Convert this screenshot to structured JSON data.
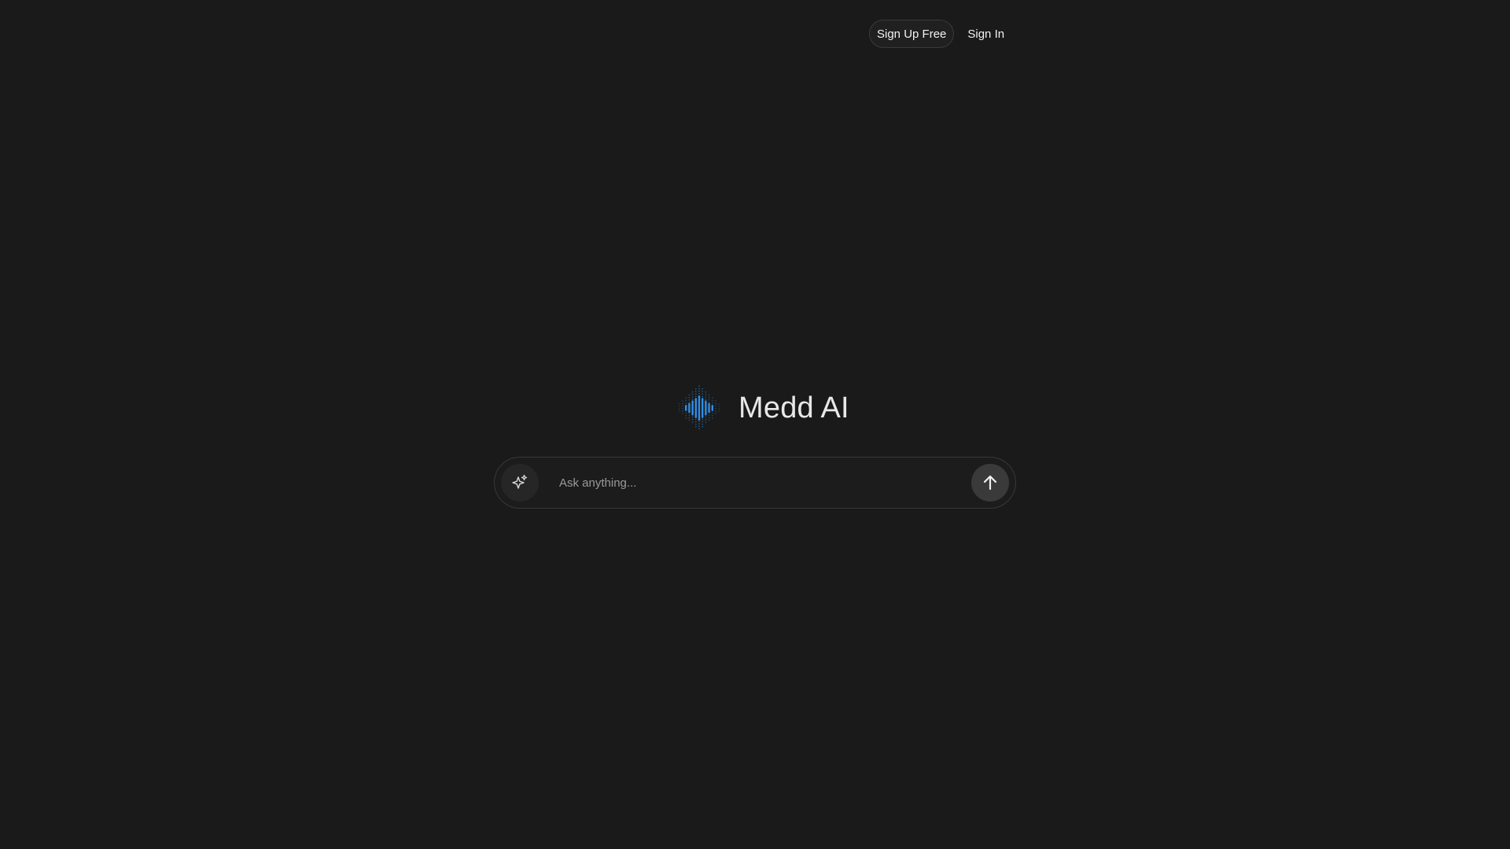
{
  "header": {
    "signup_label": "Sign Up Free",
    "signin_label": "Sign In"
  },
  "brand": {
    "name": "Medd AI",
    "logo_icon": "soundwave-logo-icon",
    "accent_color": "#2f8fe6"
  },
  "chat": {
    "placeholder": "Ask anything...",
    "value": "",
    "spark_icon": "sparkle-icon",
    "send_icon": "arrow-up-icon"
  }
}
